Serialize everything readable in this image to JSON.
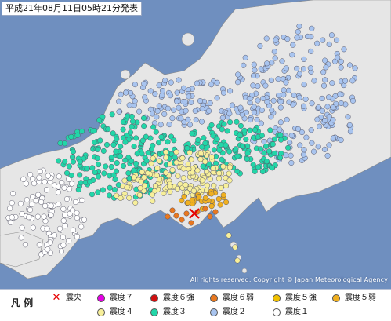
{
  "map": {
    "issue_time": "平成21年08月11日05時21分発表",
    "copyright": "All rights reserved. Copyright © Japan Meteorological Agency",
    "epicenter_label": "震央",
    "colors": {
      "sea": "#6f8fbf",
      "land": "#e6e6e6",
      "shindo_7": "#e600e6",
      "shindo_6_upper": "#d01010",
      "shindo_6_lower": "#e87820",
      "shindo_5_upper": "#f0c000",
      "shindo_5_lower": "#f0b020",
      "shindo_4": "#f7ef9a",
      "shindo_3": "#22d6a8",
      "shindo_2": "#a8c4ef",
      "shindo_1": "#ffffff",
      "epicenter": "#e60000"
    }
  },
  "legend": {
    "title": "凡 例",
    "items": [
      {
        "key": "epicenter",
        "label": "震央",
        "icon": "cross-icon"
      },
      {
        "key": "shindo_7",
        "label": "震度７"
      },
      {
        "key": "shindo_6_upper",
        "label": "震度６強"
      },
      {
        "key": "shindo_6_lower",
        "label": "震度６弱"
      },
      {
        "key": "shindo_5_upper",
        "label": "震度５強"
      },
      {
        "key": "shindo_5_lower",
        "label": "震度５弱"
      },
      {
        "key": "shindo_4",
        "label": "震度４"
      },
      {
        "key": "shindo_3",
        "label": "震度３"
      },
      {
        "key": "shindo_2",
        "label": "震度２"
      },
      {
        "key": "shindo_1",
        "label": "震度１"
      }
    ]
  }
}
